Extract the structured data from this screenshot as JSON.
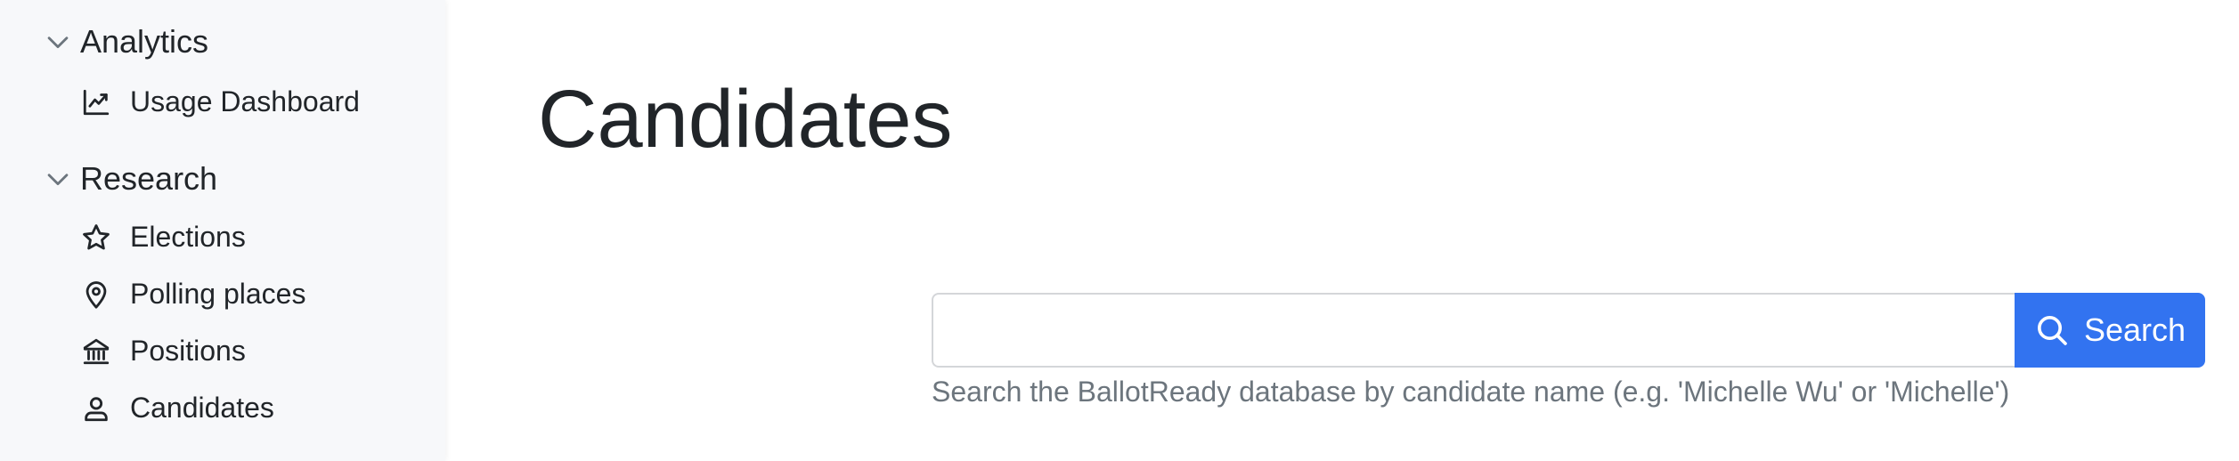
{
  "sidebar": {
    "sections": [
      {
        "title": "Analytics",
        "icon": "chevron-down-icon",
        "items": [
          {
            "label": "Usage Dashboard",
            "icon": "line-chart-icon"
          }
        ]
      },
      {
        "title": "Research",
        "icon": "chevron-down-icon",
        "items": [
          {
            "label": "Elections",
            "icon": "star-icon"
          },
          {
            "label": "Polling places",
            "icon": "map-pin-icon"
          },
          {
            "label": "Positions",
            "icon": "building-columns-icon"
          },
          {
            "label": "Candidates",
            "icon": "person-icon"
          }
        ]
      }
    ]
  },
  "main": {
    "title": "Candidates",
    "search": {
      "value": "",
      "placeholder": "",
      "button_label": "Search",
      "button_icon": "search-icon",
      "help_text": "Search the BallotReady database by candidate name (e.g. 'Michelle Wu' or 'Michelle')"
    }
  },
  "colors": {
    "sidebar_bg": "#f7f8fa",
    "accent": "#3273f0",
    "text": "#212529",
    "muted_text": "#6c757d"
  }
}
